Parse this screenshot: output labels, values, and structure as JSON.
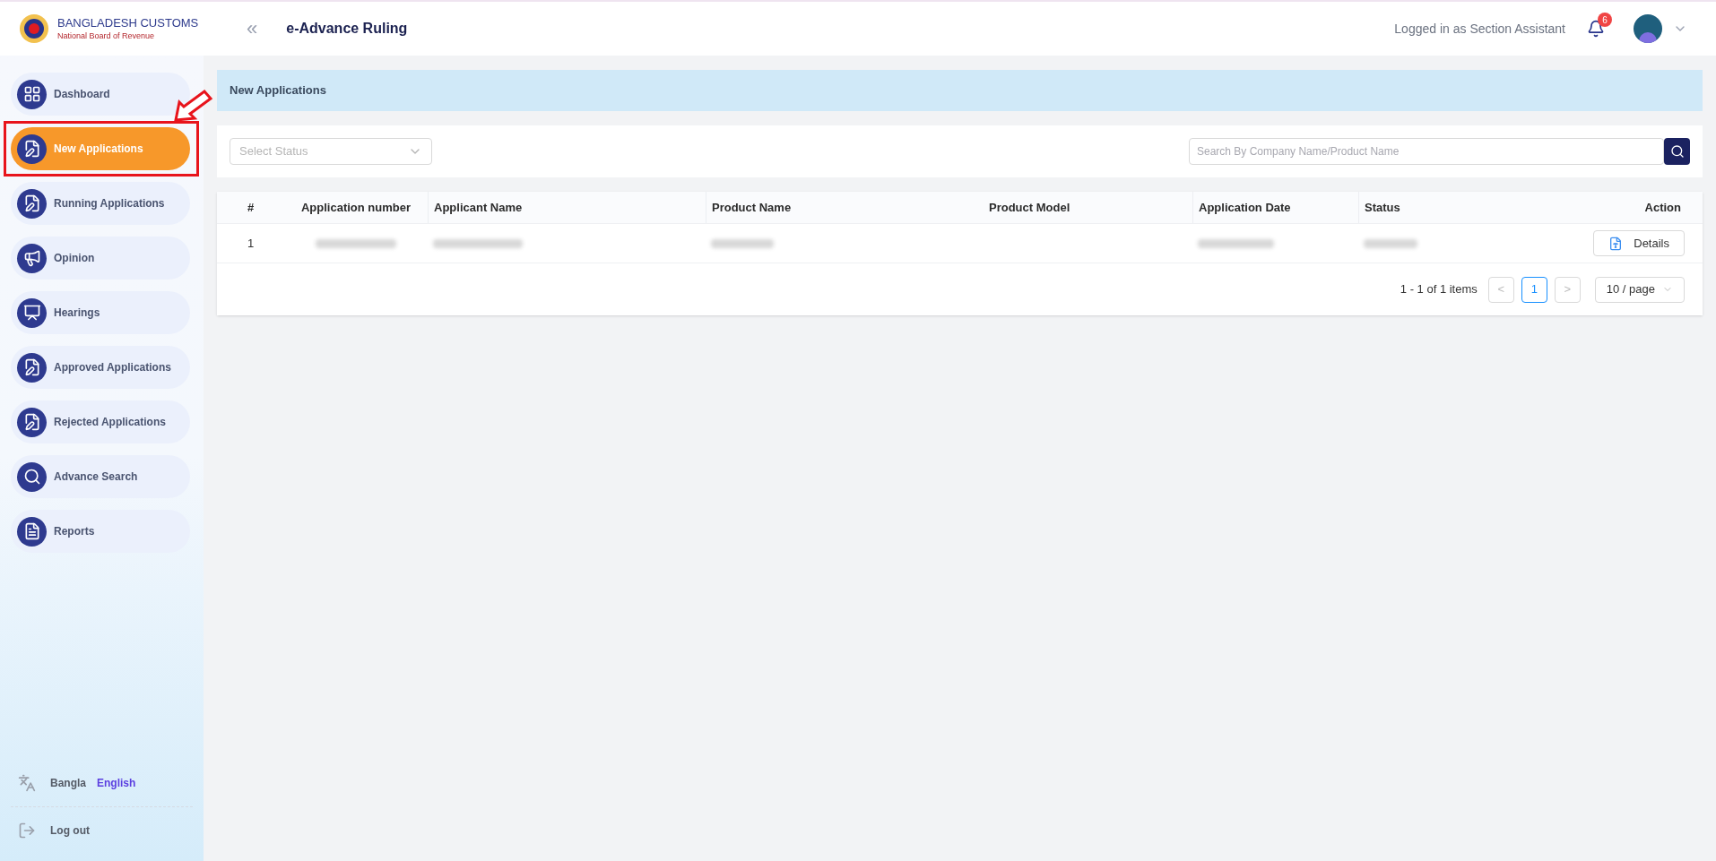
{
  "header": {
    "logo_title": "BANGLADESH CUSTOMS",
    "logo_subtitle": "National Board of Revenue",
    "collapse_glyph": "«",
    "app_title": "e-Advance Ruling",
    "logged_in": "Logged in as Section Assistant",
    "notifications": "6"
  },
  "sidebar": {
    "items": [
      {
        "label": "Dashboard",
        "kind": "grid",
        "selected": false
      },
      {
        "label": "New Applications",
        "kind": "doc",
        "selected": true,
        "highlighted": true
      },
      {
        "label": "Running Applications",
        "kind": "doc",
        "selected": false
      },
      {
        "label": "Opinion",
        "kind": "speaker",
        "selected": false
      },
      {
        "label": "Hearings",
        "kind": "board",
        "selected": false
      },
      {
        "label": "Approved Applications",
        "kind": "doc",
        "selected": false
      },
      {
        "label": "Rejected Applications",
        "kind": "doc",
        "selected": false
      },
      {
        "label": "Advance Search",
        "kind": "search",
        "selected": false
      },
      {
        "label": "Reports",
        "kind": "file",
        "selected": false
      }
    ],
    "languages": [
      {
        "label": "Bangla",
        "selected": false
      },
      {
        "label": "English",
        "selected": true
      }
    ],
    "logout": "Log out"
  },
  "page_title": "New Applications",
  "filters": {
    "status_placeholder": "Select Status",
    "search_placeholder": "Search By Company Name/Product Name"
  },
  "table": {
    "columns": [
      "#",
      "Application number",
      "Applicant Name",
      "Product Name",
      "Product Model",
      "Application Date",
      "Status",
      "Action"
    ],
    "rows": [
      {
        "index": "1",
        "cells": [
          {
            "kind": "blurred"
          },
          {
            "kind": "blurred"
          },
          {
            "kind": "blurred"
          },
          {
            "kind": "empty"
          },
          {
            "kind": "blurred"
          },
          {
            "kind": "blurred"
          }
        ],
        "action": "Details"
      }
    ]
  },
  "pagination": {
    "summary": "1 - 1 of 1 items",
    "prev": "<",
    "pages": [
      {
        "label": "1",
        "selected": true
      }
    ],
    "next": ">",
    "page_size": "10 / page"
  }
}
